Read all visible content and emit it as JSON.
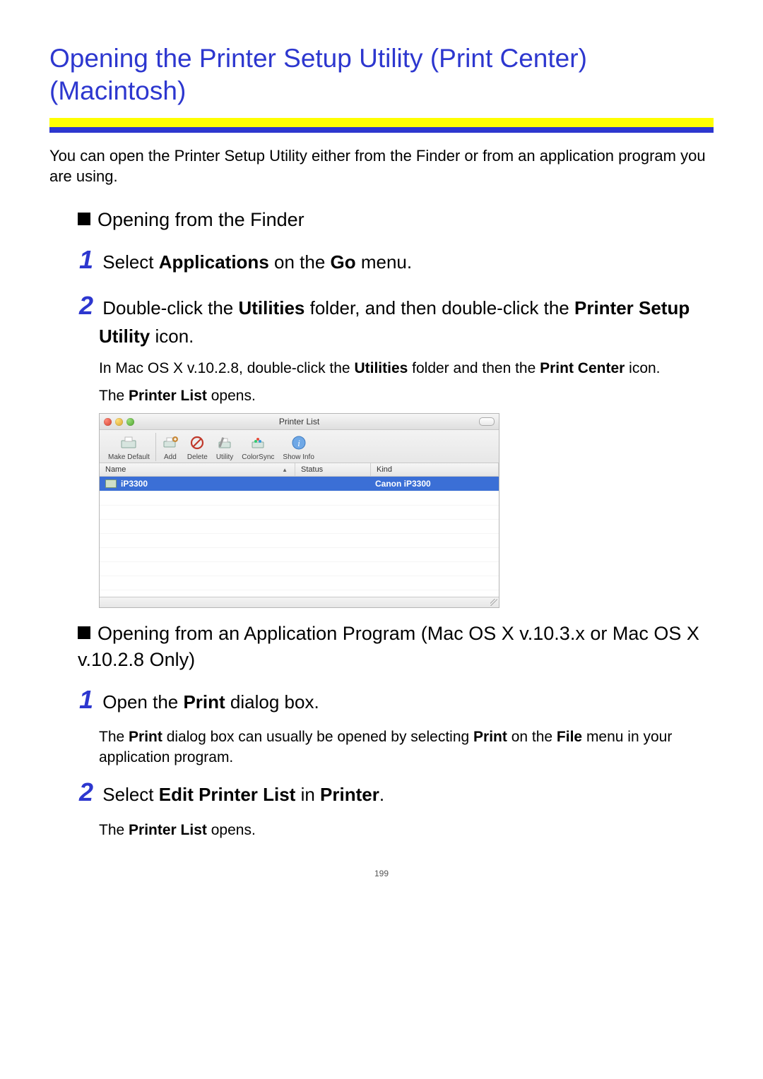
{
  "title": "Opening the Printer Setup Utility (Print Center) (Macintosh)",
  "intro": "You can open the Printer Setup Utility either from the Finder or from an application program you are using.",
  "section1": {
    "heading": "Opening from the Finder",
    "step1": {
      "pre": "Select ",
      "b1": "Applications",
      "mid": " on the ",
      "b2": "Go",
      "post": " menu."
    },
    "step2": {
      "pre": "Double-click the ",
      "b1": "Utilities",
      "mid": " folder, and then double-click the ",
      "b2": "Printer Setup Utility",
      "post": " icon."
    },
    "note1": {
      "pre": "In Mac OS X v.10.2.8, double-click the ",
      "b1": "Utilities",
      "mid": " folder and then the ",
      "b2": "Print Center",
      "post": " icon."
    },
    "note2": {
      "pre": "The ",
      "b1": "Printer List",
      "post": " opens."
    }
  },
  "printer_window": {
    "title": "Printer List",
    "toolbar": {
      "make_default": "Make Default",
      "add": "Add",
      "delete": "Delete",
      "utility": "Utility",
      "colorsync": "ColorSync",
      "show_info": "Show Info"
    },
    "cols": {
      "name": "Name",
      "status": "Status",
      "kind": "Kind"
    },
    "row": {
      "name": "iP3300",
      "status": "",
      "kind": "Canon iP3300"
    }
  },
  "section2": {
    "heading": "Opening from an Application Program (Mac OS X v.10.3.x or Mac OS X v.10.2.8 Only)",
    "step1": {
      "pre": "Open the ",
      "b1": "Print",
      "post": " dialog box."
    },
    "note1": {
      "pre": "The ",
      "b1": "Print",
      "mid1": " dialog box can usually be opened by selecting ",
      "b2": "Print",
      "mid2": " on the ",
      "b3": "File",
      "post": " menu in your application program."
    },
    "step2": {
      "pre": "Select ",
      "b1": "Edit Printer List",
      "mid": " in ",
      "b2": "Printer",
      "post": "."
    },
    "note2": {
      "pre": "The ",
      "b1": "Printer List",
      "post": " opens."
    }
  },
  "page_number": "199"
}
